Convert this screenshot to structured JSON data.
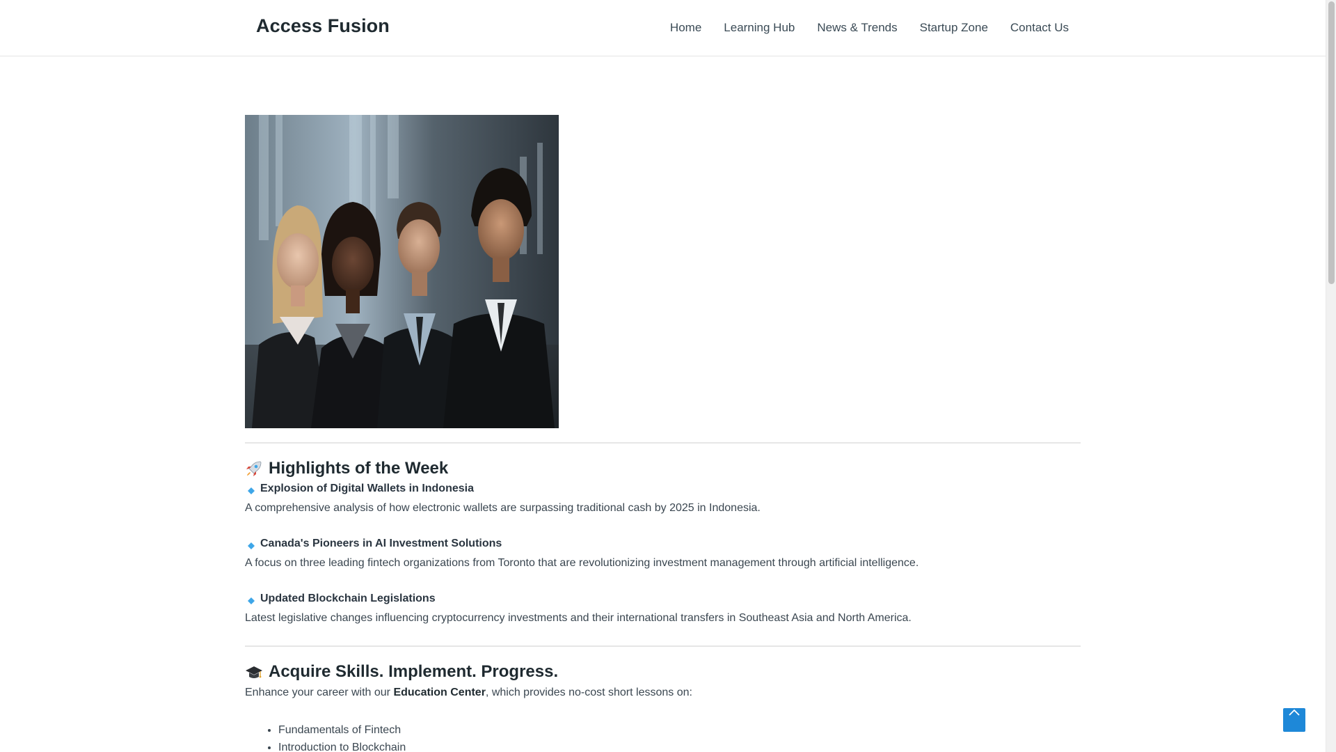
{
  "header": {
    "brand": "Access Fusion",
    "nav": [
      {
        "label": "Home"
      },
      {
        "label": "Learning Hub"
      },
      {
        "label": "News & Trends"
      },
      {
        "label": "Startup Zone"
      },
      {
        "label": "Contact Us"
      }
    ]
  },
  "hero": {
    "image_desc": "four-business-professionals-photo"
  },
  "highlights": {
    "icon": "rocket-icon",
    "title": "Highlights of the Week",
    "items": [
      {
        "title": "Explosion of Digital Wallets in Indonesia",
        "desc": "A comprehensive analysis of how electronic wallets are surpassing traditional cash by 2025 in Indonesia."
      },
      {
        "title": "Canada's Pioneers in AI Investment Solutions",
        "desc": "A focus on three leading fintech organizations from Toronto that are revolutionizing investment management through artificial intelligence."
      },
      {
        "title": "Updated Blockchain Legislations",
        "desc": "Latest legislative changes influencing cryptocurrency investments and their international transfers in Southeast Asia and North America."
      }
    ]
  },
  "skills": {
    "icon": "graduation-cap-icon",
    "title": "Acquire Skills. Implement. Progress.",
    "intro_before": "Enhance your career with our ",
    "intro_strong": "Education Center",
    "intro_after": ", which provides no-cost short lessons on:",
    "list": [
      "Fundamentals of Fintech",
      "Introduction to Blockchain"
    ]
  },
  "colors": {
    "accent": "#1e88d8",
    "diamond": "#3ea6e8",
    "text": "#333333"
  }
}
